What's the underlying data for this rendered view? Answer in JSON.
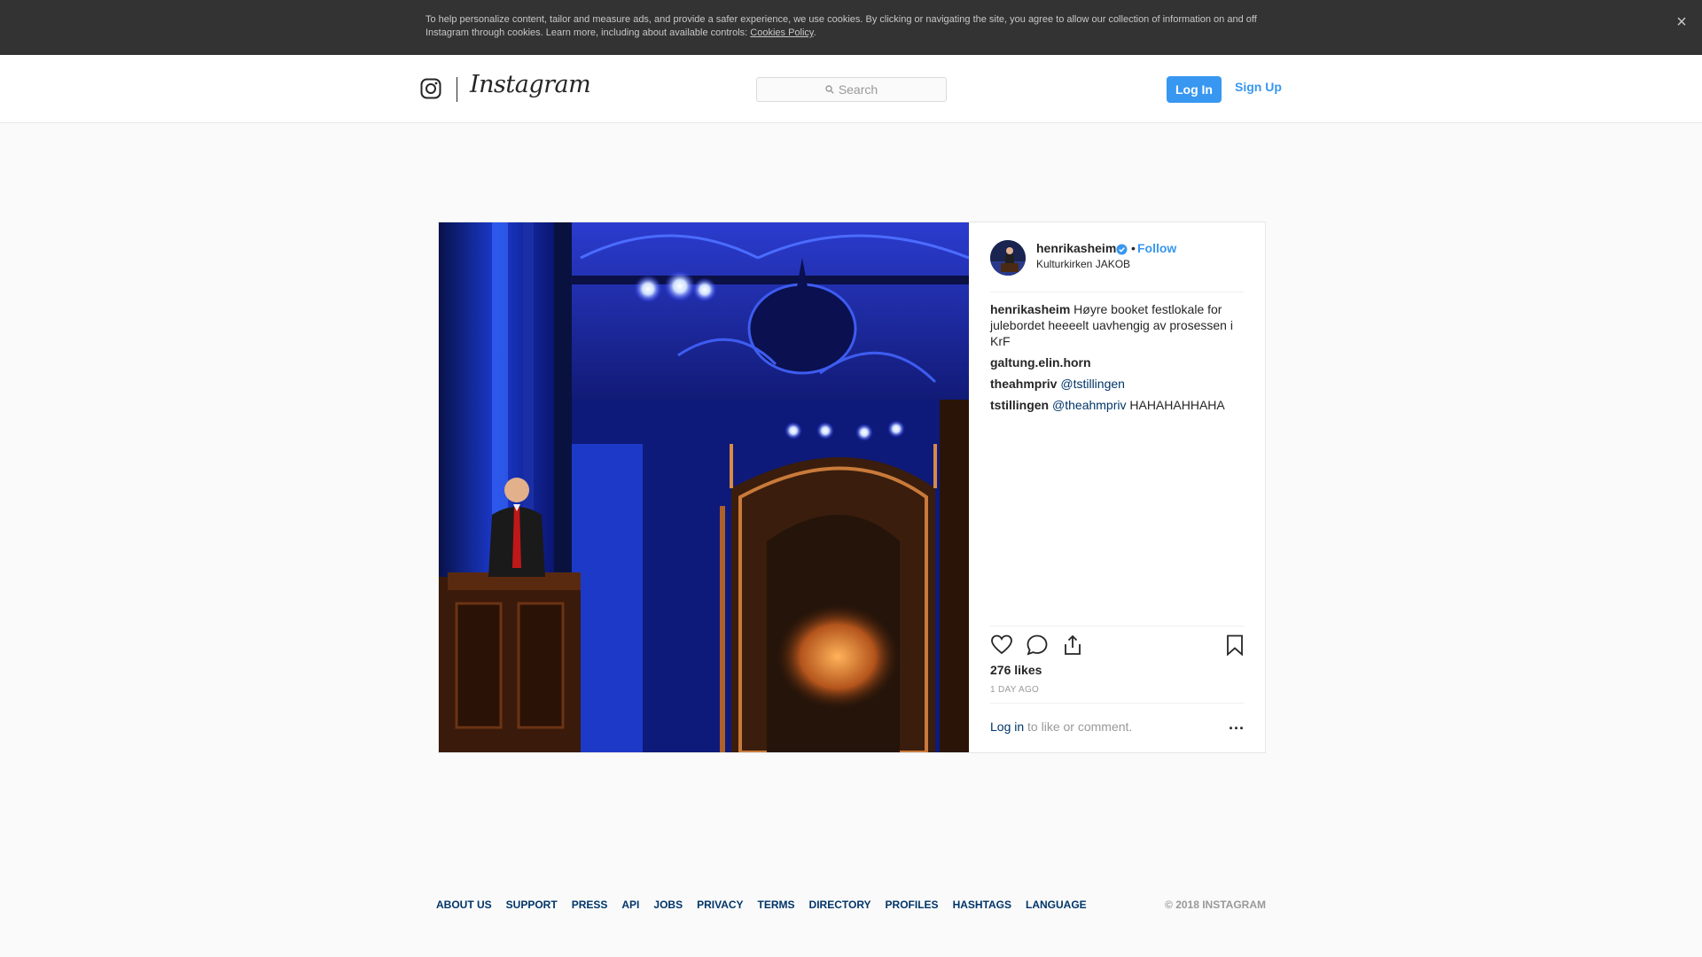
{
  "cookie_banner": {
    "text": "To help personalize content, tailor and measure ads, and provide a safer experience, we use cookies. By clicking or navigating the site, you agree to allow our collection of information on and off Instagram through cookies. Learn more, including about available controls: ",
    "link_label": "Cookies Policy",
    "close_label": "×"
  },
  "nav": {
    "logo_word": "Instagram",
    "search_placeholder": "Search",
    "login_label": "Log In",
    "signup_label": "Sign Up"
  },
  "post": {
    "username": "henrikasheim",
    "follow_label": "Follow",
    "separator": "•",
    "location": "Kulturkirken JAKOB",
    "comments": [
      {
        "user": "henrikasheim",
        "text": "Høyre booket festlokale for julebordet heeeelt uavhengig av prosessen i KrF",
        "mention": ""
      },
      {
        "user": "galtung.elin.horn",
        "text": "   ",
        "mention": ""
      },
      {
        "user": "theahmpriv",
        "text": "",
        "mention": "@tstillingen"
      },
      {
        "user": "tstillingen",
        "text": " HAHAHAHHAHA",
        "mention": "@theahmpriv"
      }
    ],
    "likes": "276 likes",
    "time": "1 DAY AGO",
    "login_link": "Log in",
    "login_suffix": " to like or comment.",
    "more_label": "..."
  },
  "footer": {
    "links": [
      "ABOUT US",
      "SUPPORT",
      "PRESS",
      "API",
      "JOBS",
      "PRIVACY",
      "TERMS",
      "DIRECTORY",
      "PROFILES",
      "HASHTAGS",
      "LANGUAGE"
    ],
    "copyright": "© 2018 INSTAGRAM"
  },
  "colors": {
    "accent": "#3897f0",
    "link_dark": "#003569",
    "banner_bg": "#333333"
  },
  "icons": [
    "close-icon",
    "instagram-glyph-icon",
    "search-icon",
    "verified-badge-icon",
    "heart-icon",
    "comment-icon",
    "share-icon",
    "bookmark-icon",
    "more-icon"
  ]
}
